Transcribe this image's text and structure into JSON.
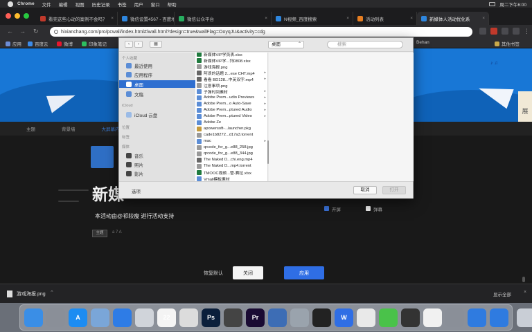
{
  "menubar": {
    "app": "Chrome",
    "items": [
      "文件",
      "编辑",
      "视图",
      "历史记录",
      "书签",
      "用户",
      "窗口",
      "帮助"
    ],
    "clock": "周二下午6:00"
  },
  "tabs": [
    {
      "label": "看完这些心动的案例不会吗？",
      "color": "#c0392b"
    },
    {
      "label": "微信设置4567 - 百度地图",
      "color": "#2e86de"
    },
    {
      "label": "微信公众平台",
      "color": "#27ae60"
    },
    {
      "label": "N视频_百度搜索",
      "color": "#2e86de"
    },
    {
      "label": "活动列表",
      "color": "#e67e22"
    },
    {
      "label": "新媒体人活动优化系",
      "color": "#2e86de",
      "active": true
    }
  ],
  "address": {
    "url": "hixianchang.com/pro/pcwall/index.html#/wall.html?design=true&wallFlag=OoyqJU&activity=cdg"
  },
  "bookmarks": [
    {
      "label": "应用",
      "color": "#6c8cd5"
    },
    {
      "label": "百度云",
      "color": "#3d8be8"
    },
    {
      "label": "微博",
      "color": "#e6162d"
    },
    {
      "label": "印象笔记",
      "color": "#2dbe60"
    },
    {
      "label": "Behan",
      "color": "#1769ff"
    },
    {
      "label": "其他书签",
      "color": "#c9a94a"
    }
  ],
  "page": {
    "nav": [
      "主题",
      "背景墙",
      "大屏幕内容"
    ],
    "title": "新媒",
    "subtitle": "本活动由@祁较瘦 进行活动支持",
    "chip": "主题",
    "chip2": "a 7 A",
    "checks": [
      "开屏",
      "弹幕"
    ],
    "buttons": {
      "restore": "恢复默认",
      "close": "关闭",
      "apply": "应用"
    }
  },
  "dialog": {
    "location": "桌面",
    "search_placeholder": "搜索",
    "favorites_head": "个人收藏",
    "favorites": [
      "最近使用",
      "应用程序",
      "桌面",
      "文稿"
    ],
    "selected_index": 2,
    "icloud_head": "iCloud",
    "icloud": [
      "iCloud 云盘"
    ],
    "locations_head": "位置",
    "devices_head": "标签",
    "tags_head": "媒体",
    "media": [
      "音乐",
      "照片",
      "影片"
    ],
    "files": [
      {
        "name": "新媒体VIP学员表.xlsx",
        "color": "#1f7a3e",
        "arrow": false
      },
      {
        "name": "新媒体VIP学...列0808.xlsx",
        "color": "#1f7a3e",
        "arrow": false
      },
      {
        "name": "游戏海报.png",
        "color": "#999999",
        "arrow": false
      },
      {
        "name": "阿浪的话题 2...ese CHT.mp4",
        "color": "#666666",
        "arrow": true
      },
      {
        "name": "看看 BD128...中英双字.mp4",
        "color": "#666666",
        "arrow": true
      },
      {
        "name": "注意事项.png",
        "color": "#999999",
        "arrow": false
      },
      {
        "name": "子弹时间素材",
        "color": "#5b8dd6",
        "arrow": true
      },
      {
        "name": "Adobe Prem...udio Previews",
        "color": "#5b8dd6",
        "arrow": true
      },
      {
        "name": "Adobe Prem...o Auto-Save",
        "color": "#5b8dd6",
        "arrow": true
      },
      {
        "name": "Adobe Prem...ptured Audio",
        "color": "#5b8dd6",
        "arrow": true
      },
      {
        "name": "Adobe Prem...ptured Video",
        "color": "#5b8dd6",
        "arrow": true
      },
      {
        "name": "Adobe Ze",
        "color": "#5b8dd6",
        "arrow": false
      },
      {
        "name": "apowersoft-...launcher.pkg",
        "color": "#c49a3c",
        "arrow": false
      },
      {
        "name": "cade1b8272...d17a3.torrent",
        "color": "#999999",
        "arrow": false
      },
      {
        "name": "mac",
        "color": "#5b8dd6",
        "arrow": true
      },
      {
        "name": "qrcode_for_g...e88_258.jpg",
        "color": "#999999",
        "arrow": false
      },
      {
        "name": "qrcode_for_g...e88_344.jpg",
        "color": "#999999",
        "arrow": false
      },
      {
        "name": "The Naked D...chi.eng.mp4",
        "color": "#666666",
        "arrow": false
      },
      {
        "name": "The Naked D...mp4.torrent",
        "color": "#999999",
        "arrow": false
      },
      {
        "name": "TMOOC视频...管-赛拉.xlsx",
        "color": "#1f7a3e",
        "arrow": false
      },
      {
        "name": "Vmall模板素材",
        "color": "#5b8dd6",
        "arrow": false
      }
    ],
    "options_label": "选项",
    "cancel": "取消",
    "open": "打开"
  },
  "downloads": {
    "file": "游戏海报.png",
    "show_all": "显示全部"
  },
  "dock": [
    {
      "name": "finder",
      "color": "#3a8ee6",
      "glyph": ""
    },
    {
      "name": "launchpad",
      "color": "#8a8f98",
      "glyph": ""
    },
    {
      "name": "app-store",
      "color": "#1c8cf2",
      "glyph": "A"
    },
    {
      "name": "preview",
      "color": "#7aa6d8",
      "glyph": ""
    },
    {
      "name": "safari",
      "color": "#2e7ce6",
      "glyph": ""
    },
    {
      "name": "photos",
      "color": "#d0d4da",
      "glyph": ""
    },
    {
      "name": "calendar",
      "color": "#f4f4f4",
      "glyph": "22"
    },
    {
      "name": "chrome",
      "color": "#dcdcdc",
      "glyph": ""
    },
    {
      "name": "photoshop",
      "color": "#0b1f3b",
      "glyph": "Ps"
    },
    {
      "name": "dreamweaver",
      "color": "#444",
      "glyph": ""
    },
    {
      "name": "premiere",
      "color": "#1a0b33",
      "glyph": "Pr"
    },
    {
      "name": "screen-recorder",
      "color": "#3d6db5",
      "glyph": ""
    },
    {
      "name": "mail",
      "color": "#9aa3ad",
      "glyph": ""
    },
    {
      "name": "obs",
      "color": "#222",
      "glyph": ""
    },
    {
      "name": "wps",
      "color": "#2f6ee5",
      "glyph": "W"
    },
    {
      "name": "qq",
      "color": "#e9e9e9",
      "glyph": ""
    },
    {
      "name": "wechat",
      "color": "#4ac24a",
      "glyph": ""
    },
    {
      "name": "music",
      "color": "#333",
      "glyph": ""
    },
    {
      "name": "notes",
      "color": "#f1f1f1",
      "glyph": ""
    },
    {
      "name": "preview-2",
      "color": "#8a8f98",
      "glyph": ""
    },
    {
      "name": "baidu-netdisk",
      "color": "#2f7be0",
      "glyph": ""
    },
    {
      "name": "download-manager",
      "color": "#2f7be0",
      "glyph": ""
    },
    {
      "name": "trash",
      "color": "#c9ced6",
      "glyph": ""
    }
  ]
}
